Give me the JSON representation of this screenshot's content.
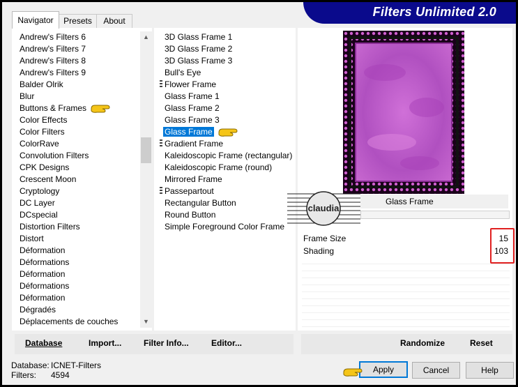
{
  "banner": {
    "title": "Filters Unlimited 2.0"
  },
  "tabs": [
    {
      "label": "Navigator",
      "active": true
    },
    {
      "label": "Presets",
      "active": false
    },
    {
      "label": "About",
      "active": false
    }
  ],
  "categories": {
    "items": [
      "Andrew's Filters 6",
      "Andrew's Filters 7",
      "Andrew's Filters 8",
      "Andrew's Filters 9",
      "Balder Olrik",
      "Blur",
      "Buttons & Frames",
      "Color Effects",
      "Color Filters",
      "ColorRave",
      "Convolution Filters",
      "CPK Designs",
      "Crescent Moon",
      "Cryptology",
      "DC Layer",
      "DCspecial",
      "Distortion Filters",
      "Distort",
      "Déformation",
      "Déformations",
      "Déformation",
      "Déformations",
      "Déformation",
      "Dégradés",
      "Déplacements de couches"
    ],
    "pointed": "Buttons & Frames"
  },
  "filters": {
    "items": [
      {
        "label": "3D Glass Frame 1",
        "group": false
      },
      {
        "label": "3D Glass Frame 2",
        "group": false
      },
      {
        "label": "3D Glass Frame 3",
        "group": false
      },
      {
        "label": "Bull's Eye",
        "group": false
      },
      {
        "label": "Flower Frame",
        "group": true
      },
      {
        "label": "Glass Frame 1",
        "group": false
      },
      {
        "label": "Glass Frame 2",
        "group": false
      },
      {
        "label": "Glass Frame 3",
        "group": false
      },
      {
        "label": "Glass Frame",
        "group": false,
        "selected": true
      },
      {
        "label": "Gradient Frame",
        "group": true
      },
      {
        "label": "Kaleidoscopic Frame (rectangular)",
        "group": false
      },
      {
        "label": "Kaleidoscopic Frame (round)",
        "group": false
      },
      {
        "label": "Mirrored Frame",
        "group": false
      },
      {
        "label": "Passepartout",
        "group": true
      },
      {
        "label": "Rectangular Button",
        "group": false
      },
      {
        "label": "Round Button",
        "group": false
      },
      {
        "label": "Simple Foreground Color Frame",
        "group": false
      }
    ]
  },
  "preview": {
    "filter_name": "Glass Frame",
    "watermark": "claudia"
  },
  "params": [
    {
      "name": "Frame Size",
      "value": "15"
    },
    {
      "name": "Shading",
      "value": "103"
    }
  ],
  "toolbar": {
    "database": "Database",
    "import": "Import...",
    "filter_info": "Filter Info...",
    "editor": "Editor...",
    "randomize": "Randomize",
    "reset": "Reset"
  },
  "status": {
    "database_label": "Database:",
    "database_value": "ICNET-Filters",
    "filters_label": "Filters:",
    "filters_value": "4594"
  },
  "dialog": {
    "apply": "Apply",
    "cancel": "Cancel",
    "help": "Help"
  },
  "colors": {
    "banner": "#0a0a8c",
    "selection": "#0078d7",
    "highlight_box": "#e02020",
    "preview_fill": "#c45ac4"
  }
}
